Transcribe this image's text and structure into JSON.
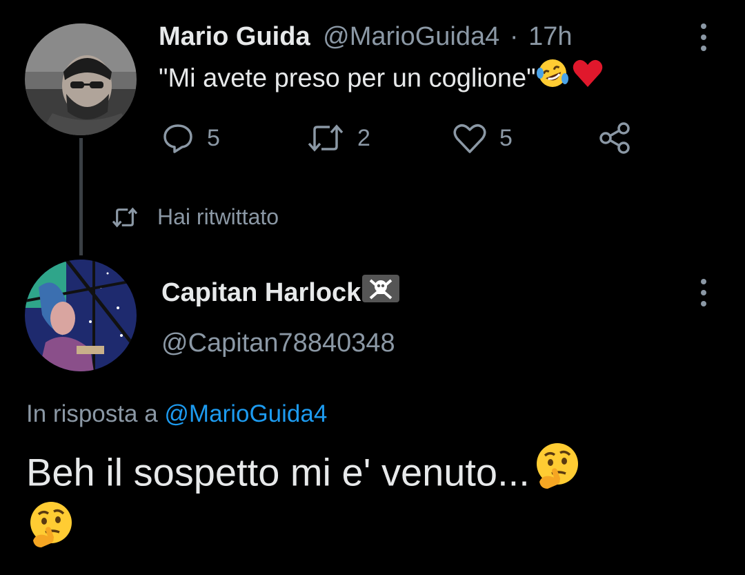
{
  "tweet1": {
    "display_name": "Mario Guida",
    "handle": "@MarioGuida4",
    "separator": "·",
    "time": "17h",
    "text": "\"Mi avete preso per un coglione\"",
    "emojis": [
      "rolling-on-floor-laughing",
      "red-heart"
    ],
    "actions": {
      "replies": "5",
      "retweets": "2",
      "likes": "5"
    }
  },
  "retweet_notice": {
    "label": "Hai ritwittato"
  },
  "tweet2": {
    "display_name": "Capitan Harlock",
    "name_emoji": "skull-and-crossbones",
    "handle": "@Capitan78840348",
    "reply_prefix": "In risposta a",
    "reply_to": "@MarioGuida4",
    "text": "Beh il sospetto mi e' venuto...",
    "emojis": [
      "thinking-face",
      "thinking-face"
    ]
  },
  "colors": {
    "background": "#000000",
    "text_primary": "#e7e9ea",
    "text_secondary": "#8b98a5",
    "link": "#1d9bf0",
    "heart": "#e0182c"
  }
}
